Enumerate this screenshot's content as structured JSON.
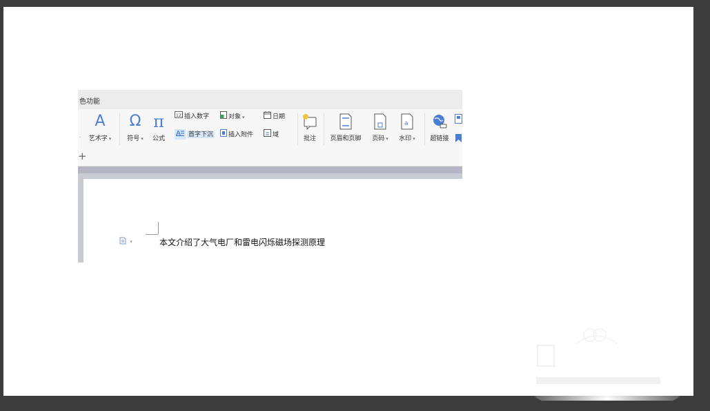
{
  "ribbon": {
    "tab_fragment": "色功能",
    "plus": "+",
    "tools": {
      "art_text": {
        "glyph": "A",
        "label": "艺术字"
      },
      "symbol": {
        "glyph": "Ω",
        "label": "符号"
      },
      "formula": {
        "glyph": "π",
        "label": "公式"
      },
      "insert_number": "插入数字",
      "object": "对象",
      "date": "日期",
      "drop_cap": "首字下沉",
      "insert_attachment": "插入附件",
      "field": "域",
      "comment": "批注",
      "header_footer": "页眉和页脚",
      "page_number": "页码",
      "watermark": "水印",
      "hyperlink": "超链接"
    },
    "left_caret": "·"
  },
  "document": {
    "body_text": "本文介绍了大气电厂和雷电闪烁磁场探测原理"
  },
  "colors": {
    "accent": "#4a7fd4",
    "background": "#3c3c3c"
  }
}
